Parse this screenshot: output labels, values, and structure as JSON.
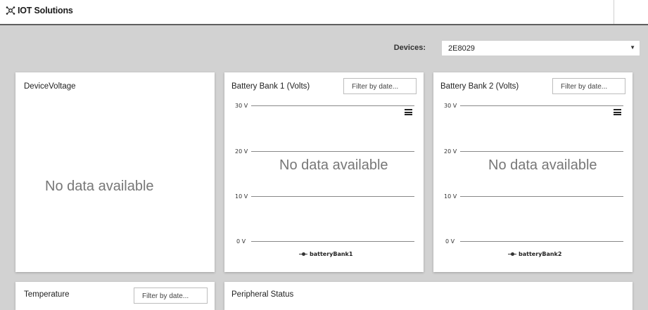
{
  "header": {
    "brand": "IOT Solutions",
    "brand_prefix": "IOT",
    "brand_suffix": "Solutions",
    "logo_icon": "network-nodes-icon"
  },
  "devices": {
    "label": "Devices:",
    "selected": "2E8029"
  },
  "cards": {
    "device_voltage": {
      "title": "DeviceVoltage",
      "empty_text": "No data available"
    },
    "battery_bank_1": {
      "title": "Battery Bank 1 (Volts)",
      "filter_placeholder": "Filter by date...",
      "empty_text": "No data available",
      "legend": "batteryBank1"
    },
    "battery_bank_2": {
      "title": "Battery Bank 2 (Volts)",
      "filter_placeholder": "Filter by date...",
      "empty_text": "No data available",
      "legend": "batteryBank2"
    },
    "temperature": {
      "title": "Temperature",
      "filter_placeholder": "Filter by date..."
    },
    "peripheral_status": {
      "title": "Peripheral Status"
    }
  },
  "chart_axis": {
    "ticks": [
      "30 V",
      "20 V",
      "10 V",
      "0 V"
    ]
  }
}
